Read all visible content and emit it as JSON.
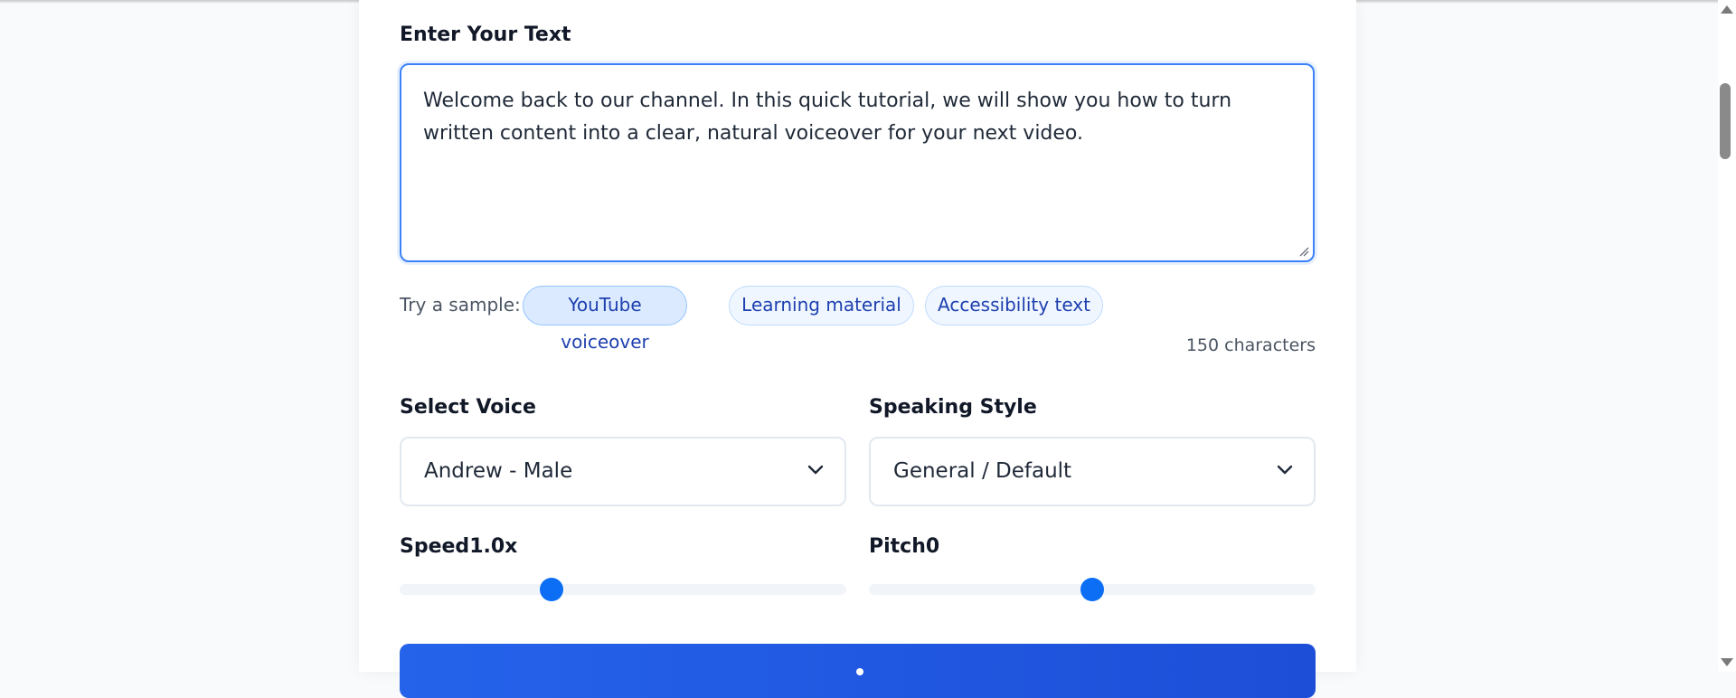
{
  "text_section": {
    "label": "Enter Your Text",
    "value": "Welcome back to our channel. In this quick tutorial, we will show you how to turn written content into a clear, natural voiceover for your next video."
  },
  "samples": {
    "label": "Try a sample:",
    "items": [
      "YouTube voiceover",
      "Learning material",
      "Accessibility text"
    ],
    "active": "YouTube voiceover"
  },
  "char_count": "150 characters",
  "voice": {
    "label": "Select Voice",
    "selected": "Andrew - Male"
  },
  "style": {
    "label": "Speaking Style",
    "selected": "General / Default"
  },
  "speed": {
    "label": "Speed",
    "value": "1.0x",
    "level": 0.34
  },
  "pitch": {
    "label": "Pitch",
    "value": "0",
    "level": 0.5
  },
  "icons": {
    "dropdown": "chevron-down-icon",
    "resize": "resize-grip-icon"
  },
  "colors": {
    "accent": "#3b82f6",
    "slider_thumb": "#0b6ef5",
    "button": "#2563eb",
    "chip_text": "#1e40af"
  }
}
